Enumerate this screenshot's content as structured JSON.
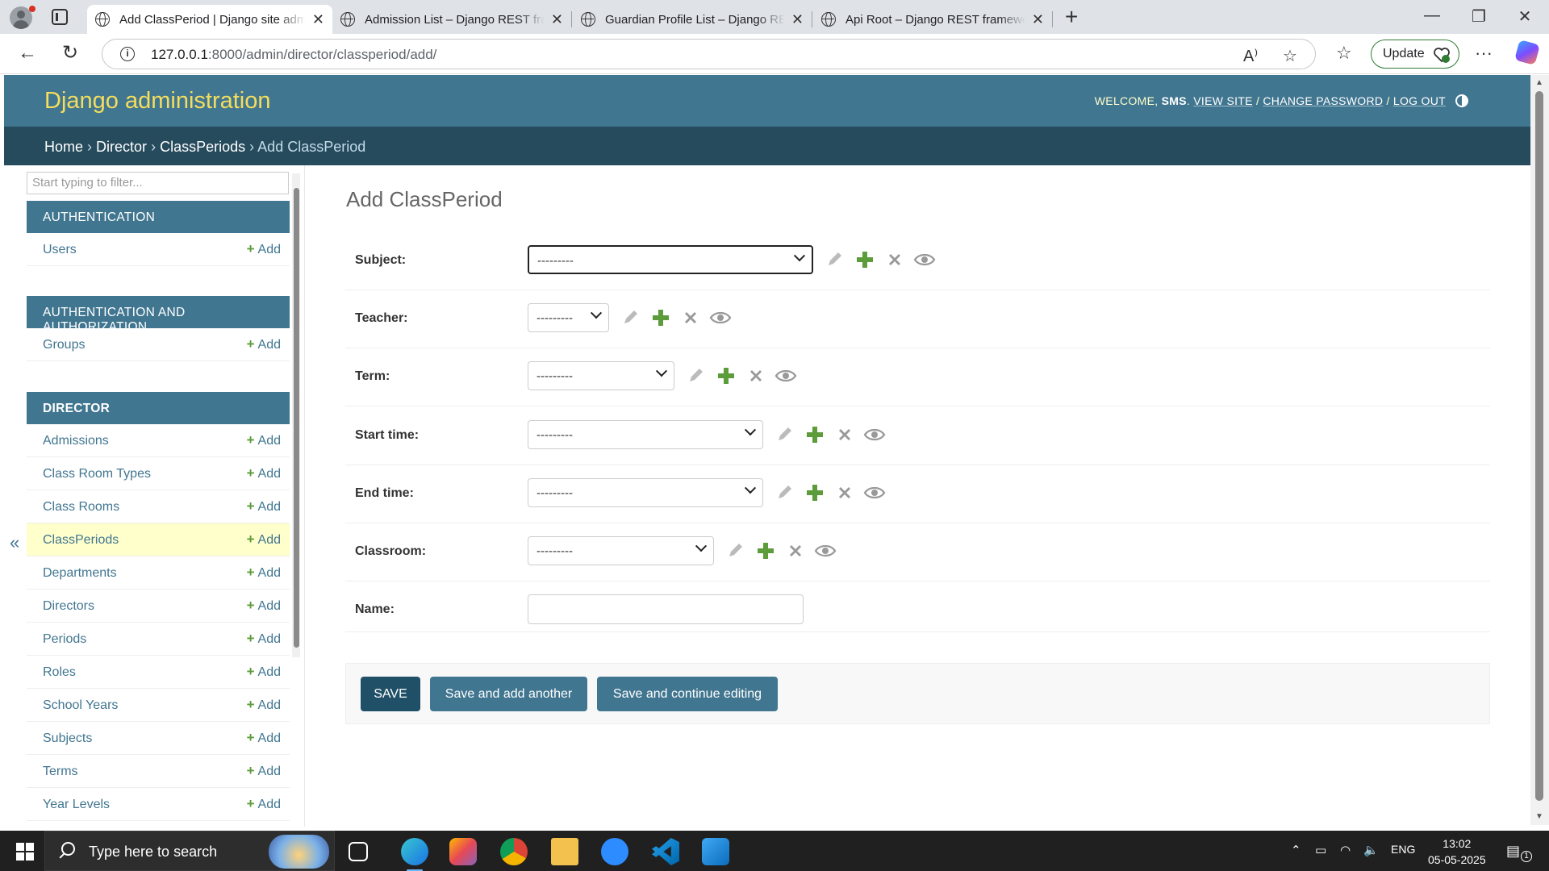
{
  "browser": {
    "tabs": [
      {
        "title": "Add ClassPeriod | Django site admin",
        "active": true
      },
      {
        "title": "Admission List – Django REST framework",
        "active": false
      },
      {
        "title": "Guardian Profile List – Django REST framework",
        "active": false
      },
      {
        "title": "Api Root – Django REST framework",
        "active": false
      }
    ],
    "url_host": "127.0.0.1",
    "url_rest": ":8000/admin/director/classperiod/add/",
    "update_label": "Update"
  },
  "header": {
    "brand": "Django administration",
    "welcome": "WELCOME,",
    "username": "SMS",
    "view_site": "VIEW SITE",
    "change_password": "CHANGE PASSWORD",
    "log_out": "LOG OUT"
  },
  "breadcrumbs": {
    "home": "Home",
    "app": "Director",
    "model": "ClassPeriods",
    "current": "Add ClassPeriod",
    "sep": "›"
  },
  "sidebar": {
    "filter_placeholder": "Start typing to filter...",
    "add_label": "Add",
    "modules": [
      {
        "caption": "AUTHENTICATION",
        "items": [
          "Users"
        ]
      },
      {
        "caption": "AUTHENTICATION AND AUTHORIZATION",
        "items": [
          "Groups"
        ]
      },
      {
        "caption": "DIRECTOR",
        "items": [
          "Admissions",
          "Class Room Types",
          "Class Rooms",
          "ClassPeriods",
          "Departments",
          "Directors",
          "Periods",
          "Roles",
          "School Years",
          "Subjects",
          "Terms",
          "Year Levels"
        ]
      }
    ],
    "current_item": "ClassPeriods",
    "collapse_label": "«"
  },
  "form": {
    "title": "Add ClassPeriod",
    "empty_option": "---------",
    "fields": [
      {
        "label": "Subject:",
        "type": "select"
      },
      {
        "label": "Teacher:",
        "type": "select"
      },
      {
        "label": "Term:",
        "type": "select"
      },
      {
        "label": "Start time:",
        "type": "select"
      },
      {
        "label": "End time:",
        "type": "select"
      },
      {
        "label": "Classroom:",
        "type": "select"
      },
      {
        "label": "Name:",
        "type": "text",
        "value": ""
      }
    ],
    "buttons": {
      "save": "SAVE",
      "save_add_another": "Save and add another",
      "save_continue": "Save and continue editing"
    }
  },
  "taskbar": {
    "search_placeholder": "Type here to search",
    "language": "ENG",
    "time": "13:02",
    "date": "05-05-2025",
    "notifications": "1"
  },
  "colors": {
    "header": "#417690",
    "breadcrumbs": "#264b5d",
    "brand": "#f5dd5d",
    "save_button": "#205067",
    "add_plus": "#5d9c3a",
    "current_row": "#ffffcc"
  }
}
